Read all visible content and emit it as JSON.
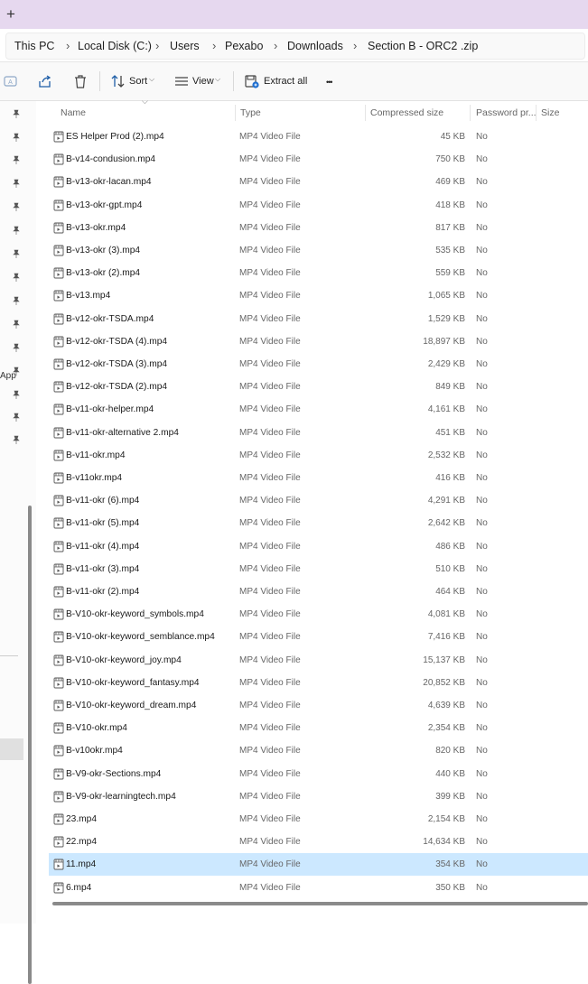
{
  "tabstrip": {
    "new_tab_glyph": "+"
  },
  "breadcrumb": [
    "This PC",
    "Local Disk (C:)",
    "Users",
    "Pexabo",
    "Downloads",
    "Section B - ORC2 .zip"
  ],
  "breadcrumb_separator": "›",
  "toolbar": {
    "sort_label": "Sort",
    "view_label": "View",
    "extract_label": "Extract all",
    "more_label": "•••",
    "icons": [
      "rename-icon",
      "share-icon",
      "delete-icon",
      "sort-icon",
      "view-icon",
      "extract-icon",
      "more-icon"
    ]
  },
  "nav": {
    "app_label": "App"
  },
  "columns": {
    "name": "Name",
    "type": "Type",
    "compressed": "Compressed size",
    "password": "Password pr...",
    "size": "Size"
  },
  "files": [
    {
      "name": "ES Helper Prod (2).mp4",
      "type": "MP4 Video File",
      "size": "45 KB",
      "pw": "No"
    },
    {
      "name": "B-v14-condusion.mp4",
      "type": "MP4 Video File",
      "size": "750 KB",
      "pw": "No"
    },
    {
      "name": "B-v13-okr-lacan.mp4",
      "type": "MP4 Video File",
      "size": "469 KB",
      "pw": "No"
    },
    {
      "name": "B-v13-okr-gpt.mp4",
      "type": "MP4 Video File",
      "size": "418 KB",
      "pw": "No"
    },
    {
      "name": "B-v13-okr.mp4",
      "type": "MP4 Video File",
      "size": "817 KB",
      "pw": "No"
    },
    {
      "name": "B-v13-okr (3).mp4",
      "type": "MP4 Video File",
      "size": "535 KB",
      "pw": "No"
    },
    {
      "name": "B-v13-okr (2).mp4",
      "type": "MP4 Video File",
      "size": "559 KB",
      "pw": "No"
    },
    {
      "name": "B-v13.mp4",
      "type": "MP4 Video File",
      "size": "1,065 KB",
      "pw": "No"
    },
    {
      "name": "B-v12-okr-TSDA.mp4",
      "type": "MP4 Video File",
      "size": "1,529 KB",
      "pw": "No"
    },
    {
      "name": "B-v12-okr-TSDA (4).mp4",
      "type": "MP4 Video File",
      "size": "18,897 KB",
      "pw": "No"
    },
    {
      "name": "B-v12-okr-TSDA (3).mp4",
      "type": "MP4 Video File",
      "size": "2,429 KB",
      "pw": "No"
    },
    {
      "name": "B-v12-okr-TSDA (2).mp4",
      "type": "MP4 Video File",
      "size": "849 KB",
      "pw": "No"
    },
    {
      "name": "B-v11-okr-helper.mp4",
      "type": "MP4 Video File",
      "size": "4,161 KB",
      "pw": "No"
    },
    {
      "name": "B-v11-okr-alternative 2.mp4",
      "type": "MP4 Video File",
      "size": "451 KB",
      "pw": "No"
    },
    {
      "name": "B-v11-okr.mp4",
      "type": "MP4 Video File",
      "size": "2,532 KB",
      "pw": "No"
    },
    {
      "name": "B-v11okr.mp4",
      "type": "MP4 Video File",
      "size": "416 KB",
      "pw": "No"
    },
    {
      "name": "B-v11-okr (6).mp4",
      "type": "MP4 Video File",
      "size": "4,291 KB",
      "pw": "No"
    },
    {
      "name": "B-v11-okr (5).mp4",
      "type": "MP4 Video File",
      "size": "2,642 KB",
      "pw": "No"
    },
    {
      "name": "B-v11-okr (4).mp4",
      "type": "MP4 Video File",
      "size": "486 KB",
      "pw": "No"
    },
    {
      "name": "B-v11-okr (3).mp4",
      "type": "MP4 Video File",
      "size": "510 KB",
      "pw": "No"
    },
    {
      "name": "B-v11-okr (2).mp4",
      "type": "MP4 Video File",
      "size": "464 KB",
      "pw": "No"
    },
    {
      "name": "B-V10-okr-keyword_symbols.mp4",
      "type": "MP4 Video File",
      "size": "4,081 KB",
      "pw": "No"
    },
    {
      "name": "B-V10-okr-keyword_semblance.mp4",
      "type": "MP4 Video File",
      "size": "7,416 KB",
      "pw": "No"
    },
    {
      "name": "B-V10-okr-keyword_joy.mp4",
      "type": "MP4 Video File",
      "size": "15,137 KB",
      "pw": "No"
    },
    {
      "name": "B-V10-okr-keyword_fantasy.mp4",
      "type": "MP4 Video File",
      "size": "20,852 KB",
      "pw": "No"
    },
    {
      "name": "B-V10-okr-keyword_dream.mp4",
      "type": "MP4 Video File",
      "size": "4,639 KB",
      "pw": "No"
    },
    {
      "name": "B-V10-okr.mp4",
      "type": "MP4 Video File",
      "size": "2,354 KB",
      "pw": "No"
    },
    {
      "name": "B-v10okr.mp4",
      "type": "MP4 Video File",
      "size": "820 KB",
      "pw": "No"
    },
    {
      "name": "B-V9-okr-Sections.mp4",
      "type": "MP4 Video File",
      "size": "440 KB",
      "pw": "No"
    },
    {
      "name": "B-V9-okr-learningtech.mp4",
      "type": "MP4 Video File",
      "size": "399 KB",
      "pw": "No"
    },
    {
      "name": "23.mp4",
      "type": "MP4 Video File",
      "size": "2,154 KB",
      "pw": "No"
    },
    {
      "name": "22.mp4",
      "type": "MP4 Video File",
      "size": "14,634 KB",
      "pw": "No"
    },
    {
      "name": "11.mp4",
      "type": "MP4 Video File",
      "size": "354 KB",
      "pw": "No",
      "selected": true
    },
    {
      "name": "6.mp4",
      "type": "MP4 Video File",
      "size": "350 KB",
      "pw": "No"
    }
  ],
  "colors": {
    "accent_selected_row": "#cce8ff",
    "tabstrip": "#e6d8ef"
  }
}
